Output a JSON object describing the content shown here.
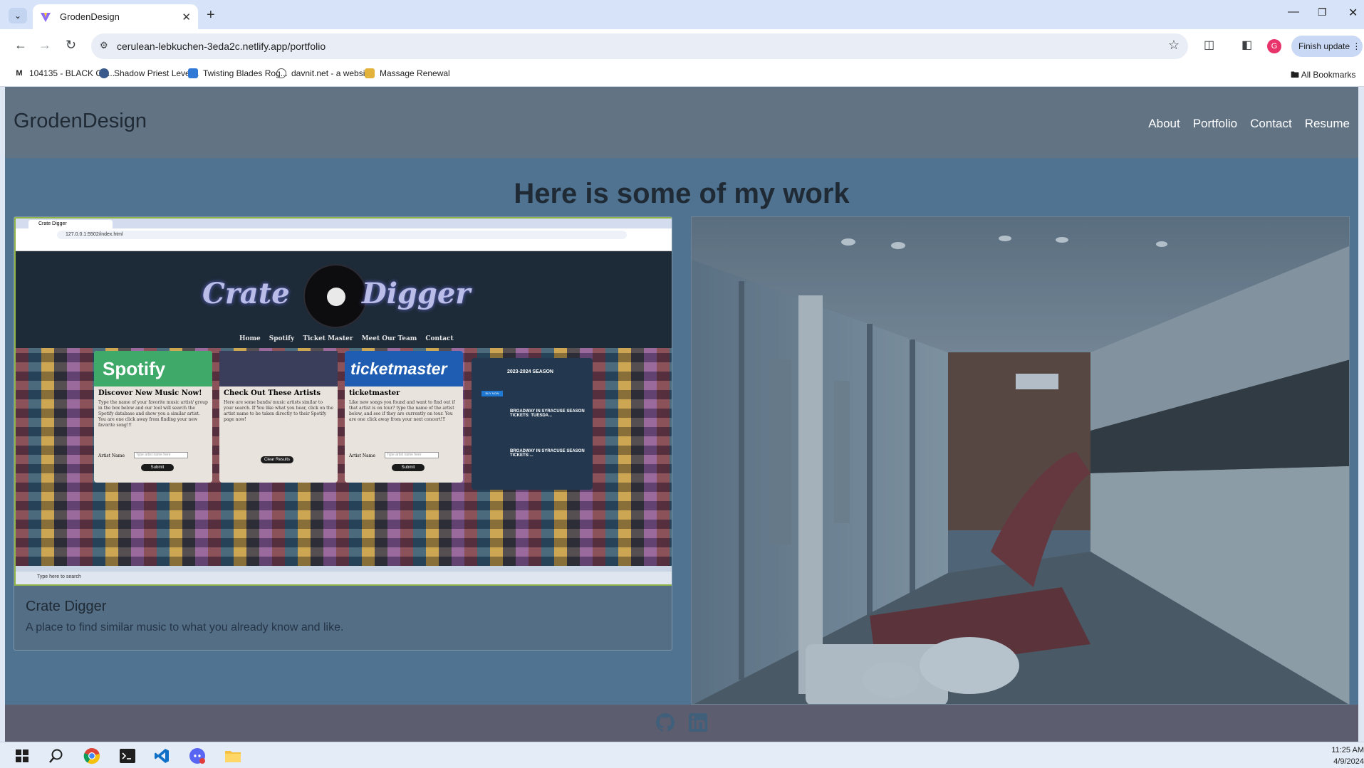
{
  "browser": {
    "tab_title": "GrodenDesign",
    "url": "cerulean-lebkuchen-3eda2c.netlify.app/portfolio",
    "finish_update_label": "Finish update",
    "avatar_letter": "G",
    "bookmarks": [
      {
        "label": "104135 - BLACK CA...",
        "icon": "M"
      },
      {
        "label": "Shadow Priest Level...",
        "icon": ""
      },
      {
        "label": "Twisting Blades Rog...",
        "icon": ""
      },
      {
        "label": "davnit.net - a website",
        "icon": ""
      },
      {
        "label": "Massage Renewal",
        "icon": ""
      }
    ],
    "all_bookmarks_label": "All Bookmarks"
  },
  "site": {
    "brand": "GrodenDesign",
    "nav": [
      "About",
      "Portfolio",
      "Contact",
      "Resume"
    ],
    "heading": "Here is some of my work",
    "projects": [
      {
        "title": "Crate Digger",
        "description": "A place to find similar music to what you already know and like.",
        "screenshot": {
          "tab_title": "Crate Digger",
          "url": "127.0.0.1:5502/index.html",
          "logo_left": "Crate",
          "logo_right": "Digger",
          "nav": [
            "Home",
            "Spotify",
            "Ticket Master",
            "Meet Our Team",
            "Contact"
          ],
          "spotify_logo": "Spotify",
          "ticketmaster_logo": "ticketmaster",
          "panels": [
            {
              "title": "Discover New Music Now!",
              "text": "Type the name of your favorite music artist/ group in the box below and our tool will search the Spotify database and show you a similar artist. You are one click away from finding your new favorite song!!!",
              "field_label": "Artist Name",
              "placeholder": "Type artist name here",
              "button": "Submit"
            },
            {
              "title": "Check Out These Artists",
              "text": "Here are some bands/ music artists similar to your search. If You like what you hear, click on the artist name to be taken directly to their Spotify page now!",
              "button": "Clear Results"
            },
            {
              "title": "ticketmaster",
              "text": "Like new songs you found and want to find out if that artist is on tour? type the name of the artist below, and see if they are currently on tour. You are one click away from your next concert!!!",
              "field_label": "Artist Name",
              "placeholder": "Type artist name here",
              "button": "Submit"
            }
          ],
          "events": [
            "2023-2024 SEASON",
            "BROADWAY IN SYRACUSE SEASON TICKETS: TUESDA...",
            "BROADWAY IN SYRACUSE SEASON TICKETS:..."
          ],
          "buy_now": "BUY NOW",
          "taskbar_search": "Type here to search"
        }
      }
    ]
  },
  "taskbar": {
    "time": "11:25 AM",
    "date": "4/9/2024"
  },
  "colors": {
    "page_bg": "#4f7390",
    "header_bg": "#627384",
    "footer_bg": "#5c5d6e",
    "card_bg": "#546e85"
  }
}
